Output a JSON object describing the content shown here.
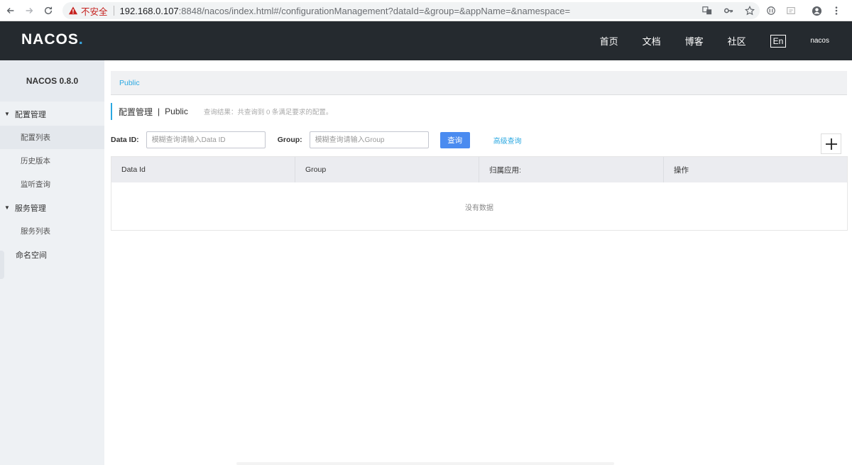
{
  "browser": {
    "insecure_label": "不安全",
    "url_host": "192.168.0.107",
    "url_rest": ":8848/nacos/index.html#/configurationManagement?dataId=&group=&appName=&namespace="
  },
  "header": {
    "logo_main": "NACOS",
    "logo_dot": ".",
    "nav": [
      "首页",
      "文档",
      "博客",
      "社区"
    ],
    "lang": "En",
    "user": "nacos"
  },
  "sidebar": {
    "title": "NACOS 0.8.0",
    "groups": [
      {
        "label": "配置管理",
        "items": [
          "配置列表",
          "历史版本",
          "监听查询"
        ]
      },
      {
        "label": "服务管理",
        "items": [
          "服务列表"
        ]
      }
    ],
    "namespace": "命名空间"
  },
  "main": {
    "namespace_link": "Public",
    "page_title": "配置管理",
    "page_sep": "|",
    "page_ns": "Public",
    "query_result": "查询结果：共查询到 0 条满足要求的配置。",
    "search": {
      "dataid_label": "Data ID:",
      "dataid_placeholder": "模糊查询请输入Data ID",
      "group_label": "Group:",
      "group_placeholder": "模糊查询请输入Group",
      "query_btn": "查询",
      "advanced_link": "高级查询"
    },
    "table": {
      "headers": [
        "Data Id",
        "Group",
        "归属应用:",
        "操作"
      ],
      "empty_text": "没有数据"
    }
  },
  "colors": {
    "header_bg": "#252a2f",
    "accent": "#2ba8e1",
    "primary_button": "#4a8bf0",
    "sidebar_bg": "#eef1f4"
  }
}
